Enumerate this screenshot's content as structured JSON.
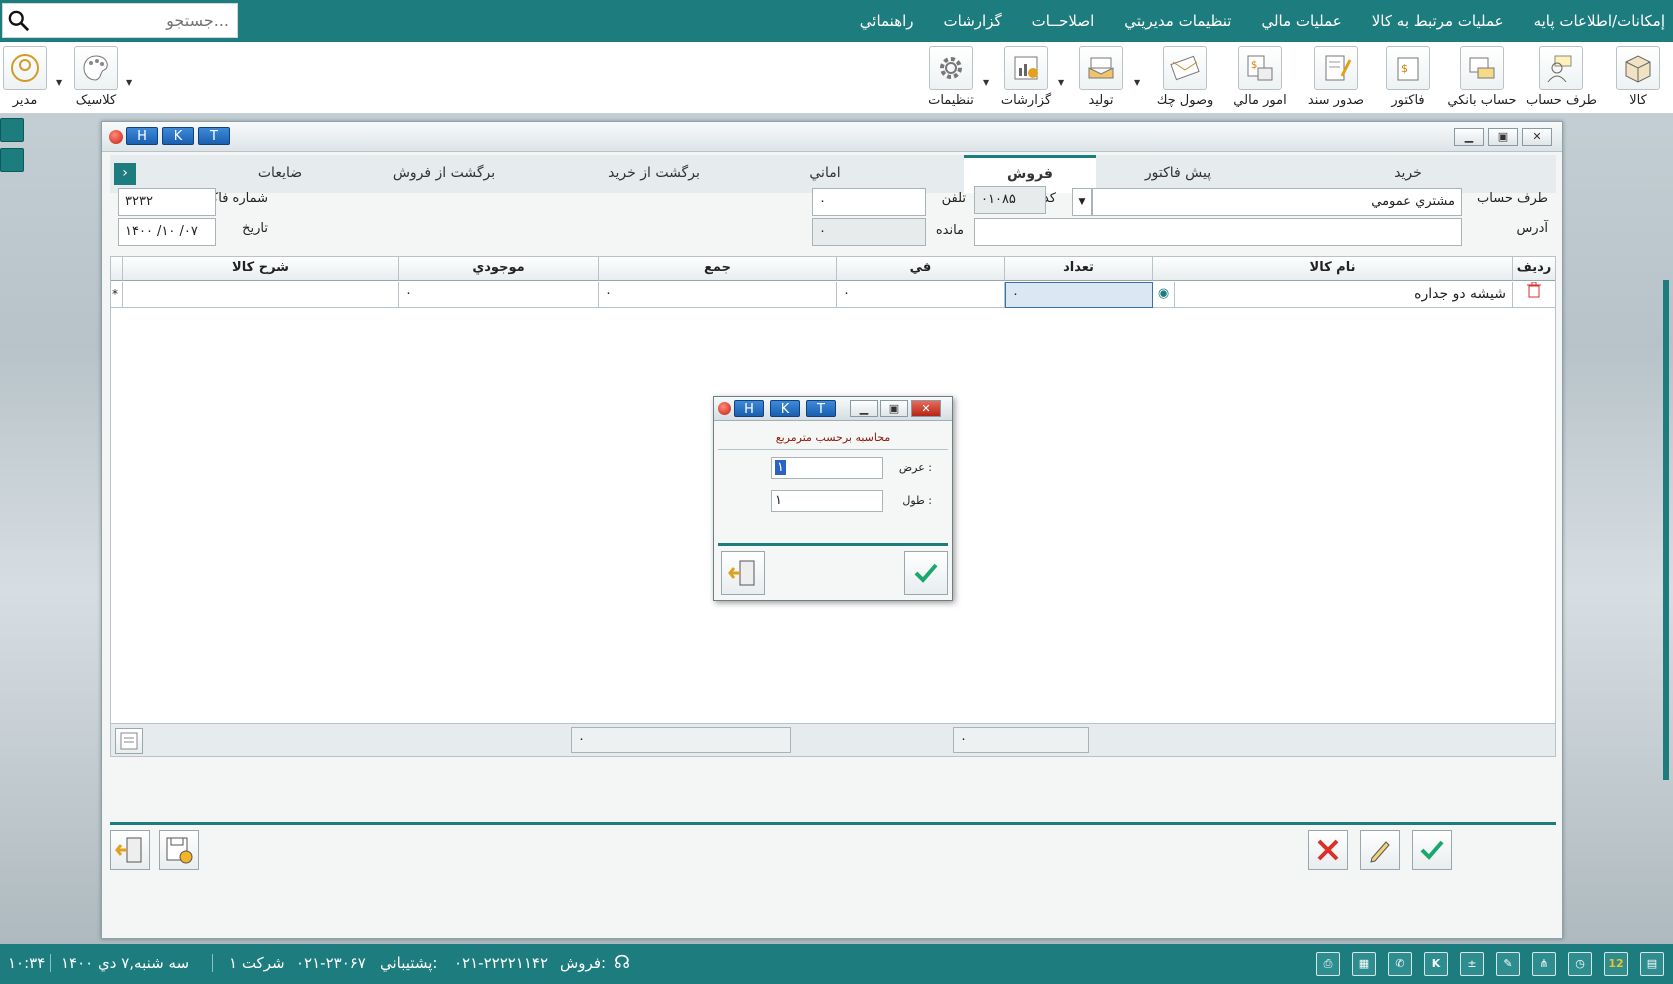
{
  "menu": {
    "items": [
      "إمكانات/اطلاعات پايه",
      "عمليات مرتبط به كالا",
      "عمليات مالي",
      "تنظيمات مديريتي",
      "اصلاحــات",
      "گزارشات",
      "راهنمائي"
    ]
  },
  "search": {
    "placeholder": "جستجو..."
  },
  "toolbar": {
    "right": [
      {
        "label": "كالا",
        "icon": "box-icon"
      },
      {
        "label": "طرف حساب",
        "icon": "person-card-icon"
      },
      {
        "label": "حساب بانكي",
        "icon": "bank-card-icon"
      },
      {
        "label": "فاكتور",
        "icon": "invoice-icon"
      },
      {
        "label": "صدور سند",
        "icon": "document-pen-icon"
      },
      {
        "label": "امور مالي",
        "icon": "money-icon"
      },
      {
        "label": "وصول چك",
        "icon": "cheque-icon"
      },
      {
        "label": "توليد",
        "icon": "production-icon"
      },
      {
        "label": "گزارشات",
        "icon": "chart-icon"
      },
      {
        "label": "تنظيمات",
        "icon": "gear-icon"
      }
    ],
    "left": [
      {
        "label": "كلاسيک",
        "icon": "palette-icon"
      },
      {
        "label": "مدير",
        "icon": "user-icon"
      }
    ]
  },
  "window": {
    "hkt": [
      "H",
      "K",
      "T"
    ]
  },
  "tabs": [
    "خريد",
    "پيش فاكتور",
    "فروش",
    "اماني",
    "برگشت از خريد",
    "برگشت از فروش",
    "ضايعات"
  ],
  "form": {
    "account_label": "طرف حساب",
    "account_value": "مشتري عمومي",
    "code_label": "كد",
    "code_value": "۰۱۰۸۵",
    "phone_label": "تلفن",
    "phone_value": "۰",
    "address_label": "آدرس",
    "address_value": "",
    "balance_label": "مانده",
    "balance_value": "۰",
    "invoice_no_label": "شماره فاكتور",
    "invoice_no_value": "۳۲۳۲",
    "date_label": "تاريخ",
    "date_value": "۱۴۰۰ /۱۰ /۰۷"
  },
  "grid": {
    "headers": {
      "row": "رديف",
      "name": "نام كالا",
      "qty": "تعداد",
      "price": "في",
      "total": "جمع",
      "stock": "موجودي",
      "desc": "شرح كالا"
    },
    "rows": [
      {
        "name": "شيشه دو جداره",
        "qty": "۰",
        "price": "۰",
        "total": "۰",
        "stock": "۰",
        "desc": ""
      }
    ],
    "new_row_marker": "*"
  },
  "footer": {
    "sum_total": "۰",
    "sum_qty": "۰"
  },
  "dialog": {
    "title": "محاسبه برحسب مترمربع",
    "width_label": "عرض :",
    "width_value": "۱",
    "length_label": "طول :",
    "length_value": "۱",
    "hkt": [
      "H",
      "K",
      "T"
    ]
  },
  "status": {
    "time": "۱۰:۳۴",
    "date": "سه شنبه,۷ دي ۱۴۰۰",
    "company": "شركت ۱",
    "sales": "فروش:",
    "sales_phone": "۰۲۱-۲۲۲۲۱۱۴۲",
    "support": "پشتيباني:",
    "support_phone": "۰۲۱-۲۳۰۶۷",
    "calendar_day": "12"
  },
  "colors": {
    "accent": "#1c7c7e",
    "confirm": "#1aa86e",
    "cancel": "#d9302a"
  }
}
